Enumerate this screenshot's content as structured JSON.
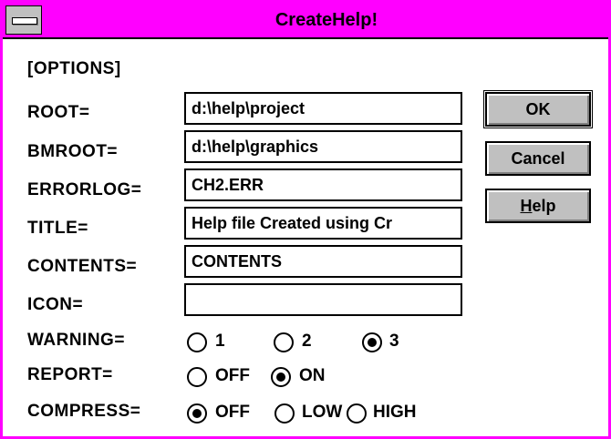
{
  "window": {
    "title": "CreateHelp!",
    "colors": {
      "titlebar": "#ff00ff",
      "button_face": "#c0c0c0"
    }
  },
  "section_label": "[OPTIONS]",
  "fields": [
    {
      "label": "ROOT=",
      "value": "d:\\help\\project"
    },
    {
      "label": "BMROOT=",
      "value": "d:\\help\\graphics"
    },
    {
      "label": "ERRORLOG=",
      "value": "CH2.ERR"
    },
    {
      "label": "TITLE=",
      "value": "Help file Created using Cr"
    },
    {
      "label": "CONTENTS=",
      "value": "CONTENTS"
    },
    {
      "label": "ICON=",
      "value": ""
    }
  ],
  "buttons": {
    "ok": "OK",
    "cancel": "Cancel",
    "help_underline": "H",
    "help_rest": "elp"
  },
  "radio_groups": {
    "warning": {
      "label": "WARNING=",
      "options": [
        "1",
        "2",
        "3"
      ],
      "selected": "3"
    },
    "report": {
      "label": "REPORT=",
      "options": [
        "OFF",
        "ON"
      ],
      "selected": "ON"
    },
    "compress": {
      "label": "COMPRESS=",
      "options": [
        "OFF",
        "LOW",
        "HIGH"
      ],
      "selected": "OFF"
    }
  }
}
